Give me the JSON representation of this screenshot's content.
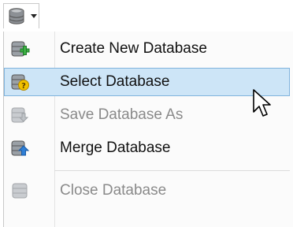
{
  "toolbar": {
    "database_button_icon": "database-icon",
    "dropdown_caret_icon": "caret-down-icon"
  },
  "menu": {
    "items": [
      {
        "label": "Create New Database",
        "icon": "database-add-icon",
        "enabled": true
      },
      {
        "label": "Select Database",
        "icon": "database-question-icon",
        "enabled": true,
        "highlighted": true
      },
      {
        "label": "Save Database As",
        "icon": "database-save-icon",
        "enabled": false
      },
      {
        "label": "Merge Database",
        "icon": "database-merge-icon",
        "enabled": true
      },
      {
        "label": "Close Database",
        "icon": "database-close-icon",
        "enabled": false
      }
    ]
  },
  "cursor": {
    "icon": "mouse-pointer-icon"
  },
  "colors": {
    "highlight_bg": "#cde5f7",
    "highlight_border": "#7fb3dd",
    "disabled_text": "#8a8a8a",
    "accent_green": "#3cb043",
    "accent_blue": "#2f7fd6",
    "accent_yellow": "#f2c200"
  }
}
